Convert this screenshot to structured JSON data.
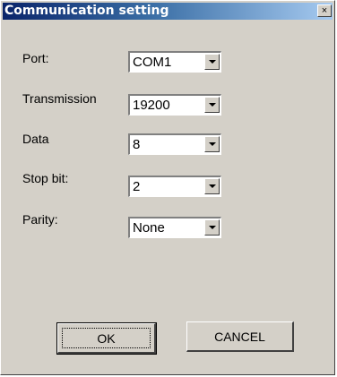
{
  "dialog": {
    "title": "Communication setting",
    "close_label": "×"
  },
  "fields": [
    {
      "label": "Port:",
      "value": "COM1"
    },
    {
      "label": "Transmission",
      "value": "19200"
    },
    {
      "label": "Data",
      "value": "8"
    },
    {
      "label": "Stop bit:",
      "value": "2"
    },
    {
      "label": "Parity:",
      "value": "None"
    }
  ],
  "buttons": {
    "ok_label": "OK",
    "cancel_label": "CANCEL"
  }
}
